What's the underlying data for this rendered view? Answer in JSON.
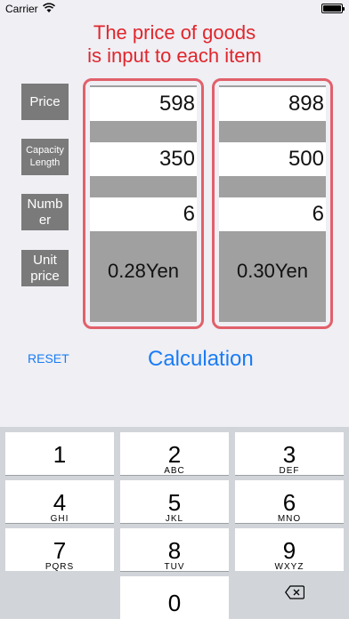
{
  "status_bar": {
    "carrier": "Carrier"
  },
  "headline": {
    "line1": "The price of goods",
    "line2": "is input to each item"
  },
  "row_labels": {
    "price": "Price",
    "capacity_line1": "Capacity",
    "capacity_line2": "Length",
    "number_line1": "Numb",
    "number_line2": "er",
    "unit_line1": "Unit",
    "unit_line2": "price"
  },
  "items": [
    {
      "price": "598",
      "capacity": "350",
      "number": "6",
      "unit_price": "0.28Yen"
    },
    {
      "price": "898",
      "capacity": "500",
      "number": "6",
      "unit_price": "0.30Yen"
    }
  ],
  "actions": {
    "reset": "RESET",
    "calculate": "Calculation"
  },
  "keypad": {
    "keys": [
      {
        "num": "1",
        "sub": ""
      },
      {
        "num": "2",
        "sub": "ABC"
      },
      {
        "num": "3",
        "sub": "DEF"
      },
      {
        "num": "4",
        "sub": "GHI"
      },
      {
        "num": "5",
        "sub": "JKL"
      },
      {
        "num": "6",
        "sub": "MNO"
      },
      {
        "num": "7",
        "sub": "PQRS"
      },
      {
        "num": "8",
        "sub": "TUV"
      },
      {
        "num": "9",
        "sub": "WXYZ"
      }
    ],
    "zero": "0",
    "delete_icon": "backspace-icon"
  },
  "colors": {
    "accent_blue": "#1a7cf5",
    "headline_red": "#e0262c",
    "column_border": "#e1606a"
  }
}
